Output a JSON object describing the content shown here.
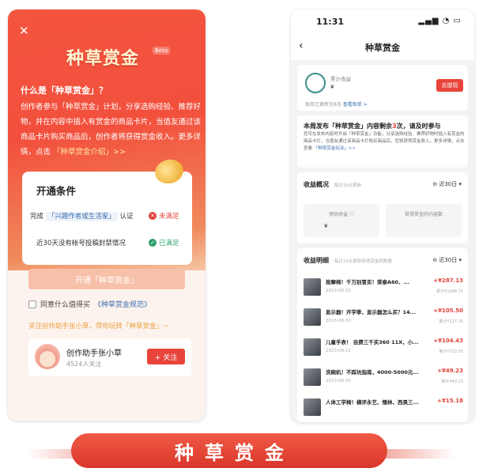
{
  "left": {
    "close_icon_glyph": "✕",
    "hero_title": "种草赏金",
    "beta_badge": "Beta",
    "what_heading": "什么是「种草赏金」？",
    "intro_text": "创作者参与「种草赏金」计划，分享选购经验、推荐好物，并在内容中插入有赏金的商品卡片，当值友通过该商品卡片购买商品后，创作者将获得赏金收入。更多详情，点击",
    "intro_link": "「种草赏金介绍」>>",
    "conditions": {
      "title": "开通条件",
      "row1_prefix": "完成",
      "row1_tag": "「兴趣作者或生活家」",
      "row1_suffix": "认证",
      "row1_status": "未满足",
      "row2_text": "近30天没有帐号投稿封禁情况",
      "row2_status": "已满足"
    },
    "open_button": "开通「种草赏金」",
    "agree_text": "同意什么值得买",
    "agree_link": "《种草赏金规范》",
    "follow_hint": "关注创作助手张小草，带你玩转「种草赏金」~",
    "account": {
      "name": "创作助手张小草",
      "fans": "4524人关注",
      "follow_button": "+ 关注"
    }
  },
  "right": {
    "status_time": "11:31",
    "status_icons": "▂▄▆ ◔ ▭",
    "nav_back": "‹",
    "nav_title": "种草赏金",
    "earn": {
      "label": "累计收益",
      "value": "¥",
      "withdraw": "去提现",
      "note": "账单已更新至8月",
      "note_link": "查看账单 >"
    },
    "notice": {
      "head_prefix": "本周发布「种草赏金」内容剩余",
      "head_count": "3",
      "head_suffix": "次，请及时参与",
      "body": "您可在发布内容时开启「种草赏金」功能，分享选购经验、推荐好物时插入有赏金的商品卡片，当值友通过该商品卡片购买商品后，您将获得赏金收入，更多详情，点击查看",
      "body_link": "「种草赏金玩法」>>"
    },
    "overview": {
      "title": "收益概况",
      "sub": "每日10点更新",
      "range": "⊖ 近30日 ▾",
      "stat1_label": "预估收益 ⓘ",
      "stat1_value": "¥",
      "stat2_label": "获得赏金的内容数"
    },
    "detail": {
      "title": "收益明细",
      "sub": "每日10点更新获得赏金的数据",
      "range": "⊖ 近30日 ▾",
      "rows": [
        {
          "title": "按摩椅！千万别冒买！荣泰A60、...",
          "date": "2023-08-25",
          "amount": "+¥287.13",
          "total": "累计¥1098.75"
        },
        {
          "title": "显示器！开学季，显示器怎么买？14...",
          "date": "2023-08-30",
          "amount": "+¥105.50",
          "total": "累计¥127.25"
        },
        {
          "title": "儿童手表！ 自费三千买360 11X，小...",
          "date": "2023-08-21",
          "amount": "+¥104.43",
          "total": "累计¥722.55"
        },
        {
          "title": "洗碗机！不踩坑指南，4000-5000元...",
          "date": "2023-08-20",
          "amount": "+¥49.23",
          "total": "累计¥49.23"
        },
        {
          "title": "人体工学椅！横评永艺、惬林、西昊三...",
          "date": "",
          "amount": "+¥15.18",
          "total": ""
        }
      ]
    }
  },
  "banner": {
    "text": "种草赏金"
  }
}
